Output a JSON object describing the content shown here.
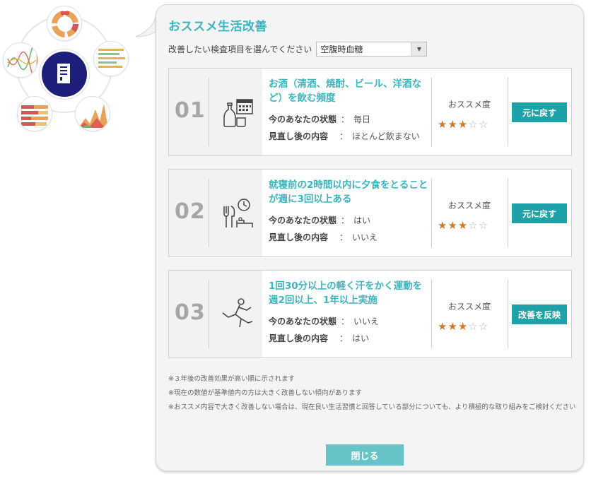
{
  "panel": {
    "title": "おススメ生活改善",
    "select_label": "改善したい検査項目を選んでください",
    "select_value": "空腹時血糖"
  },
  "labels": {
    "current_state": "今のあなたの状態",
    "after_review": "見直し後の内容",
    "colon": "：",
    "recommend": "おススメ度"
  },
  "items": [
    {
      "number": "01",
      "icon": "alcohol-calendar-icon",
      "title": "お酒（清酒、焼酎、ビール、洋酒など）を飲む頻度",
      "current": "毎日",
      "after": "ほとんど飲まない",
      "rating": 3,
      "rating_max": 5,
      "button": "元に戻す"
    },
    {
      "number": "02",
      "icon": "dinner-before-bed-icon",
      "title": "就寝前の2時間以内に夕食をとることが週に3回以上ある",
      "current": "はい",
      "after": "いいえ",
      "rating": 3,
      "rating_max": 5,
      "button": "元に戻す"
    },
    {
      "number": "03",
      "icon": "running-icon",
      "title": "1回30分以上の軽く汗をかく運動を週2回以上、1年以上実施",
      "current": "いいえ",
      "after": "はい",
      "rating": 3,
      "rating_max": 5,
      "button": "改善を反映"
    }
  ],
  "notes": [
    "※３年後の改善効果が高い順に示されます",
    "※現在の数値が基準値内の方は大きく改善しない傾向があります",
    "※おススメ内容で大きく改善しない場合は、現在良い生活習慣と回答している部分についても、より積極的な取り組みをご検討ください"
  ],
  "close_button": "閉じる",
  "colors": {
    "accent": "#3cb5bf",
    "button": "#1ea2a8",
    "close": "#66c3c8",
    "star_on": "#cf7a2b",
    "navy": "#1c1f7a"
  }
}
